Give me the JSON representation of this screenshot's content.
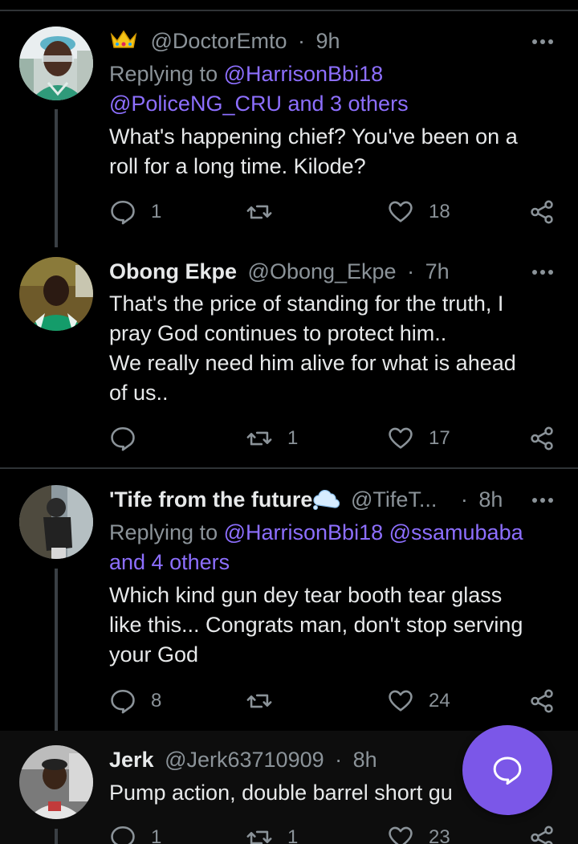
{
  "tweets": [
    {
      "badge": "👑",
      "display_name": "",
      "handle": "@DoctorEmto",
      "dot": "·",
      "time": "9h",
      "replying_prefix": "Replying to",
      "replying_line1": "@HarrisonBbi18",
      "replying_line2": "@PoliceNG_CRU and 3 others",
      "text": "What's happening chief? You've been on a\nroll for a long time. Kilode?",
      "replies": "1",
      "retweets": "",
      "likes": "18"
    },
    {
      "display_name": "Obong Ekpe",
      "handle": "@Obong_Ekpe",
      "dot": "·",
      "time": "7h",
      "text": "That's the price of standing for the truth, I\npray God continues to protect him..\nWe really need him alive for what is ahead\nof us..",
      "replies": "",
      "retweets": "1",
      "likes": "17"
    },
    {
      "display_name": "'Tife from the future",
      "handle": "@TifeT...",
      "dot": "·",
      "time": "8h",
      "replying_prefix": "Replying to",
      "replying_line1": "@HarrisonBbi18 @ssamubaba",
      "replying_line2": "and 4 others",
      "text": "Which kind gun dey tear booth tear glass\nlike this... Congrats man, don't stop serving\nyour God",
      "replies": "8",
      "retweets": "",
      "likes": "24"
    },
    {
      "display_name": "Jerk",
      "handle": "@Jerk63710909",
      "dot": "·",
      "time": "8h",
      "text": "Pump action, double barrel short gu",
      "replies": "1",
      "retweets": "1",
      "likes": "23"
    }
  ],
  "colors": {
    "background": "#000000",
    "link": "#8d6fff",
    "muted": "#8b9399",
    "fab": "#7b57e8"
  },
  "icons": {
    "reply": "reply-icon",
    "retweet": "retweet-icon",
    "like": "heart-icon",
    "share": "share-icon",
    "more": "more-icon",
    "fab": "compose-reply-icon"
  }
}
